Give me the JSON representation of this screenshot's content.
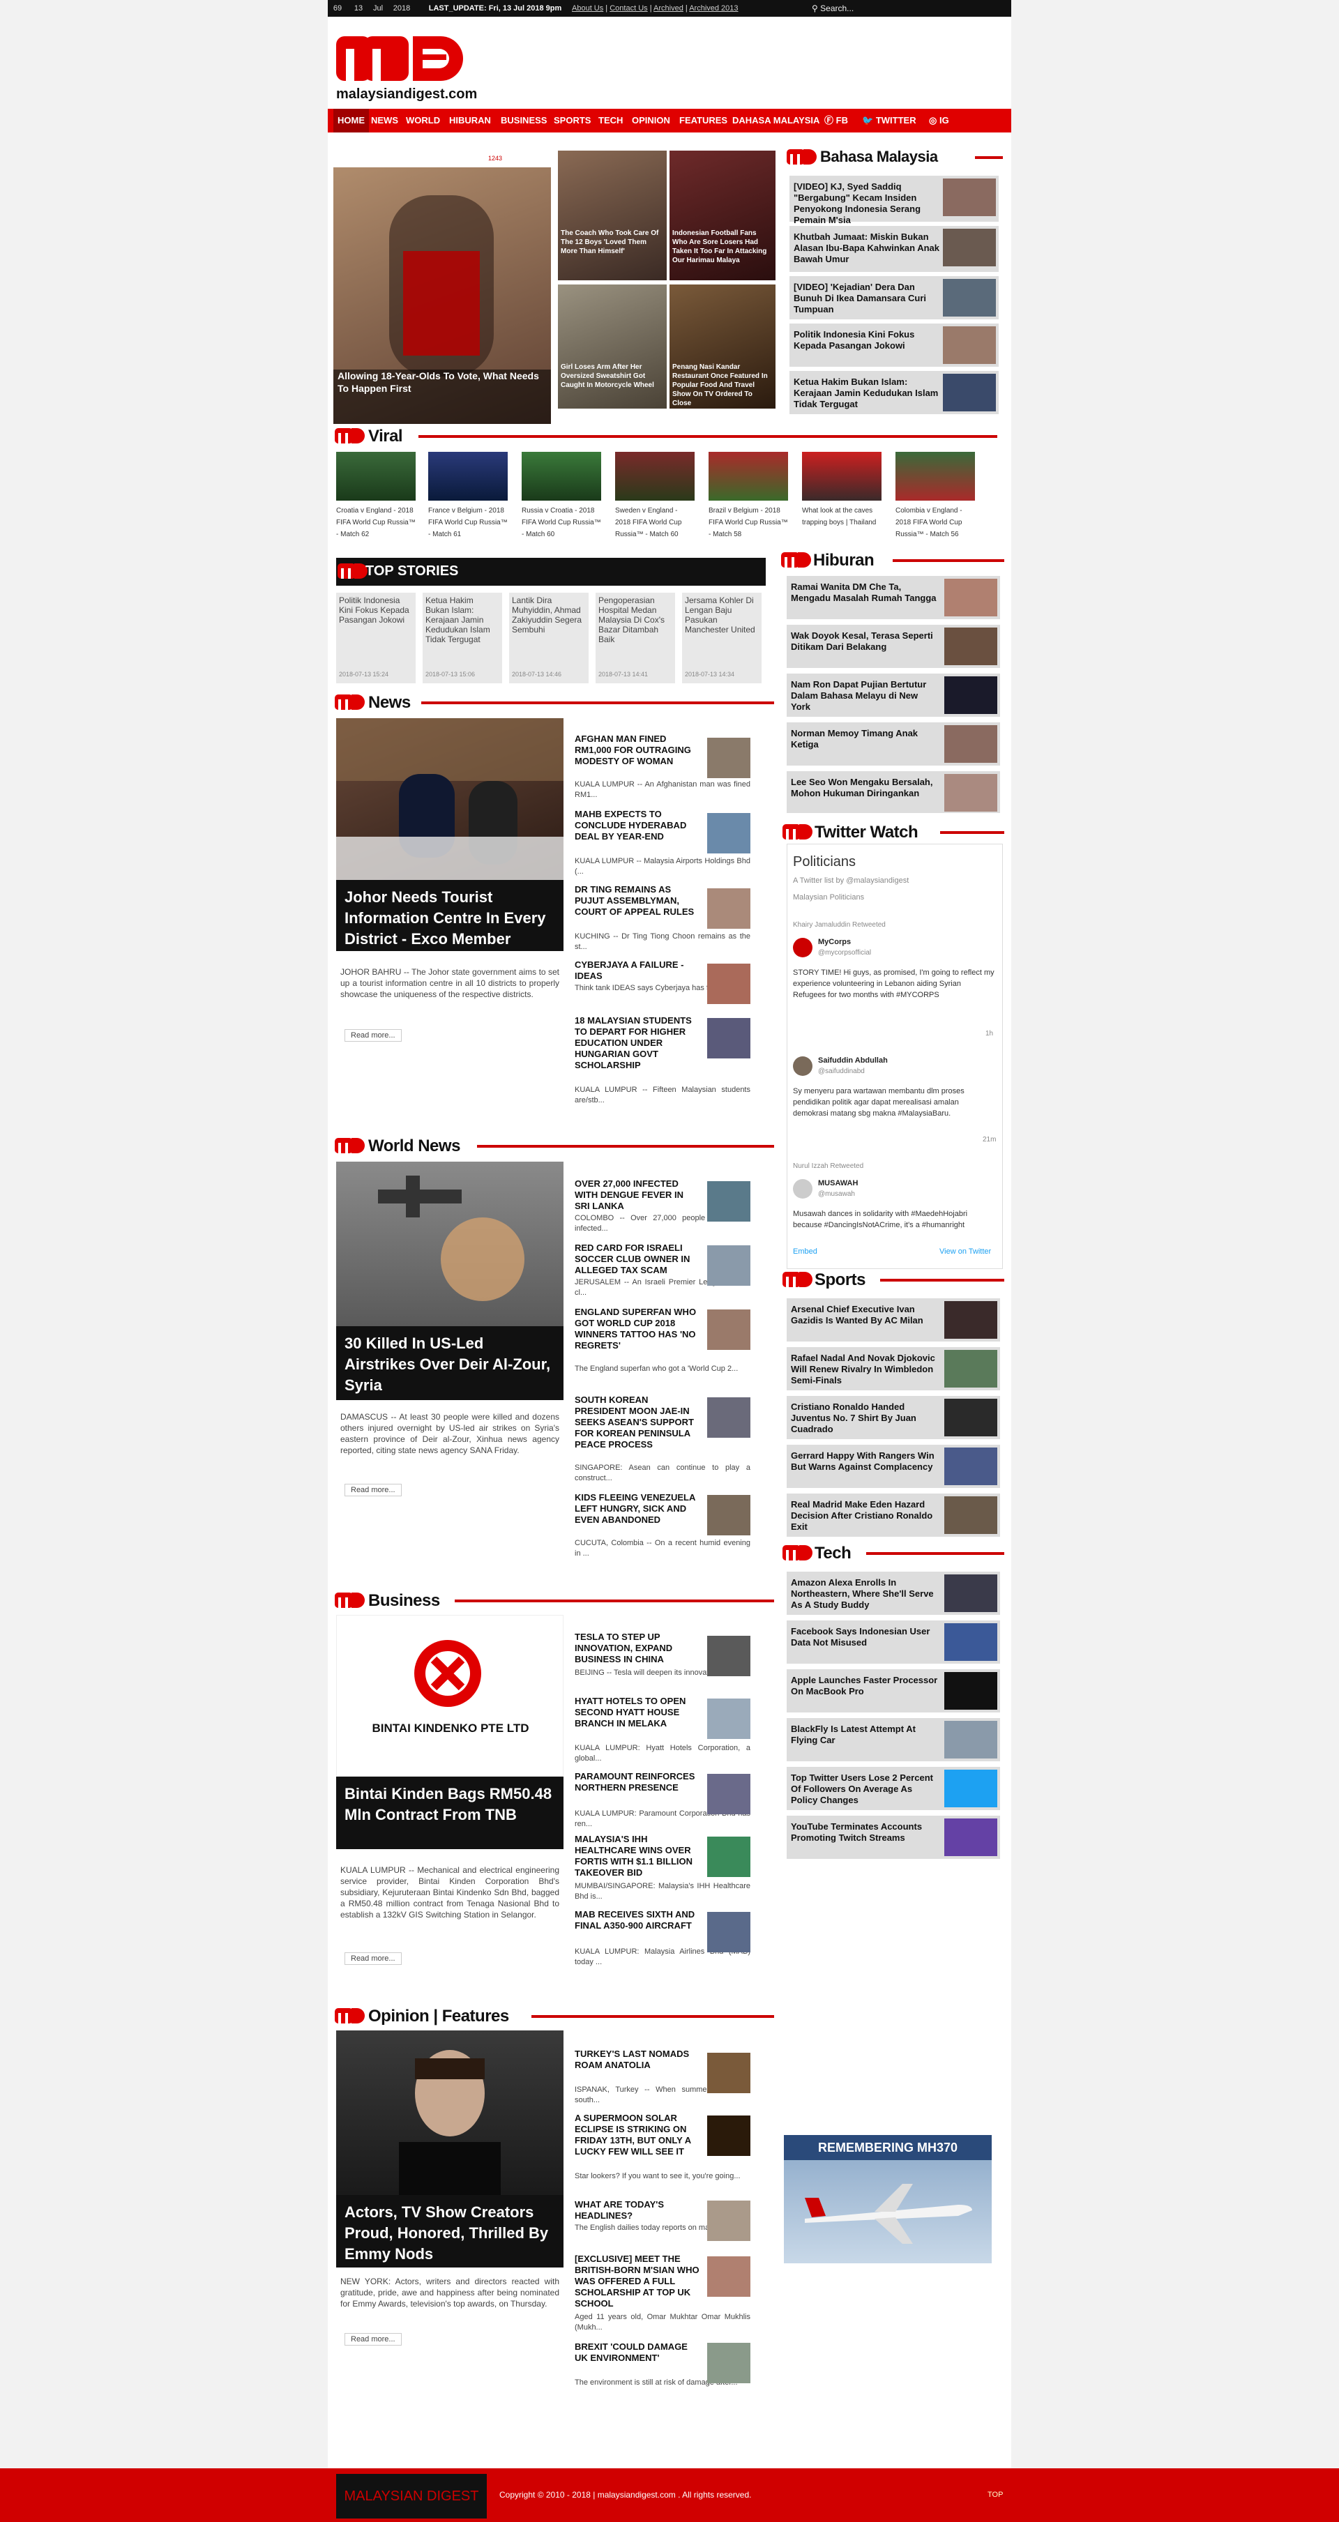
{
  "topbar": {
    "counter": "",
    "b1": "69",
    "b2": "13",
    "b3": "Jul",
    "year": "2018",
    "last_update": "LAST_UPDATE: Fri, 13 Jul 2018 9pm",
    "links": [
      "About Us",
      "Contact Us",
      "Archived",
      "Archived 2013"
    ],
    "search_placeholder": "Search..."
  },
  "logo": {
    "text": "malaysiandigest.com"
  },
  "nav": {
    "items": [
      "HOME",
      "NEWS",
      "WORLD",
      "HIBURAN",
      "BUSINESS",
      "SPORTS",
      "TECH",
      "OPINION",
      "FEATURES",
      "DAHASA MALAYSIA",
      "FB",
      "TWITTER",
      "IG"
    ]
  },
  "hero": {
    "main_title": "Allowing 18-Year-Olds To Vote, What Needs To Happen First",
    "counter": "1243",
    "grid": [
      {
        "title": "The Coach Who Took Care Of The 12 Boys 'Loved Them More Than Himself'"
      },
      {
        "title": "Indonesian Football Fans Who Are Sore Losers Had Taken It Too Far In Attacking Our Harimau Malaya"
      },
      {
        "title": "Girl Loses Arm After Her Oversized Sweatshirt Got Caught In Motorcycle Wheel"
      },
      {
        "title": "Penang Nasi Kandar Restaurant Once Featured In Popular Food And Travel Show On TV Ordered To Close"
      }
    ]
  },
  "bahasa": {
    "heading": "Bahasa Malaysia",
    "items": [
      "[VIDEO] KJ, Syed Saddiq \"Bergabung\" Kecam Insiden Penyokong Indonesia Serang Pemain M'sia",
      "Khutbah Jumaat: Miskin Bukan Alasan Ibu-Bapa Kahwinkan Anak Bawah Umur",
      "[VIDEO] 'Kejadian' Dera Dan Bunuh Di Ikea Damansara Curi Tumpuan",
      "Politik Indonesia Kini Fokus Kepada Pasangan Jokowi",
      "Ketua Hakim Bukan Islam: Kerajaan Jamin Kedudukan Islam Tidak Tergugat"
    ]
  },
  "viral": {
    "heading": "Viral",
    "items": [
      "Croatia v England - 2018 FIFA World Cup Russia™ - Match 62",
      "France v Belgium - 2018 FIFA World Cup Russia™ - Match 61",
      "Russia v Croatia - 2018 FIFA World Cup Russia™ - Match 60",
      "Sweden v England - 2018 FIFA World Cup Russia™ - Match 60",
      "Brazil v Belgium - 2018 FIFA World Cup Russia™ - Match 58",
      "What look at the caves trapping boys | Thailand",
      "Colombia v England - 2018 FIFA World Cup Russia™ - Match 56"
    ]
  },
  "top_stories": {
    "heading": "TOP STORIES",
    "items": [
      {
        "title": "Politik Indonesia Kini Fokus Kepada Pasangan Jokowi",
        "date": "2018-07-13 15:24"
      },
      {
        "title": "Ketua Hakim Bukan Islam: Kerajaan Jamin Kedudukan Islam Tidak Tergugat",
        "date": "2018-07-13 15:06"
      },
      {
        "title": "Lantik Dira Muhyiddin, Ahmad Zakiyuddin Segera Sembuhi",
        "date": "2018-07-13 14:46"
      },
      {
        "title": "Pengoperasian Hospital Medan Malaysia Di Cox's Bazar Ditambah Baik",
        "date": "2018-07-13 14:41"
      },
      {
        "title": "Jersama Kohler Di Lengan Baju Pasukan Manchester United",
        "date": "2018-07-13 14:34"
      }
    ]
  },
  "hiburan": {
    "heading": "Hiburan",
    "items": [
      "Ramai Wanita DM Che Ta, Mengadu Masalah Rumah Tangga",
      "Wak Doyok Kesal, Terasa Seperti Ditikam Dari Belakang",
      "Nam Ron Dapat Pujian Bertutur Dalam Bahasa Melayu di New York",
      "Norman Memoy Timang Anak Ketiga",
      "Lee Seo Won Mengaku Bersalah, Mohon Hukuman Diringankan"
    ]
  },
  "news": {
    "heading": "News",
    "feature_title": "Johor Needs Tourist Information Centre In Every District - Exco Member",
    "feature_excerpt": "JOHOR BAHRU -- The Johor state government aims to set up a tourist information centre in all 10 districts to properly showcase the uniqueness of the respective districts.",
    "read_more": "Read more...",
    "list": [
      {
        "title": "AFGHAN MAN FINED RM1,000 FOR OUTRAGING MODESTY OF WOMAN",
        "ex": "KUALA LUMPUR -- An Afghanistan man was fined RM1..."
      },
      {
        "title": "MAHB EXPECTS TO CONCLUDE HYDERABAD DEAL BY YEAR-END",
        "ex": "KUALA LUMPUR -- Malaysia Airports Holdings Bhd (..."
      },
      {
        "title": "DR TING REMAINS AS PUJUT ASSEMBLYMAN, COURT OF APPEAL RULES",
        "ex": "KUCHING -- Dr Ting Tiong Choon remains as the st..."
      },
      {
        "title": "CYBERJAYA A FAILURE - IDEAS",
        "ex": "Think tank IDEAS says Cyberjaya has failed in it..."
      },
      {
        "title": "18 MALAYSIAN STUDENTS TO DEPART FOR HIGHER EDUCATION UNDER HUNGARIAN GOVT SCHOLARSHIP",
        "ex": "KUALA LUMPUR -- Fifteen Malaysian students are/stb..."
      }
    ]
  },
  "twitter": {
    "heading": "Twitter Watch",
    "title": "Politicians",
    "byline": "A Twitter list by @malaysiandigest",
    "sub": "Malaysian Politicians",
    "tweets": [
      {
        "retweet": "Khairy Jamaluddin Retweeted",
        "name": "MyCorps",
        "handle": "@mycorpsofficial",
        "text": "STORY TIME! Hi guys, as promised, I'm going to reflect my experience volunteering in Lebanon aiding Syrian Refugees for two months with #MYCORPS",
        "meta": "1h"
      },
      {
        "retweet": "",
        "name": "Saifuddin Abdullah",
        "handle": "@saifuddinabd",
        "text": "Sy menyeru para wartawan membantu dlm proses pendidikan politik agar dapat merealisasi amalan demokrasi matang sbg makna #MalaysiaBaru.",
        "meta": "21m"
      },
      {
        "retweet": "Nurul Izzah Retweeted",
        "name": "MUSAWAH",
        "handle": "@musawah",
        "text": "Musawah dances in solidarity with #MaedehHojabri because #DancingIsNotACrime, it's a #humanright",
        "meta": ""
      }
    ],
    "embed": "Embed",
    "view_on": "View on Twitter"
  },
  "world": {
    "heading": "World News",
    "feature_title": "30 Killed In US-Led Airstrikes Over Deir Al-Zour, Syria",
    "feature_excerpt": "DAMASCUS -- At least 30 people were killed and dozens others injured overnight by US-led air strikes on Syria's eastern province of Deir al-Zour, Xinhua news agency reported, citing state news agency SANA Friday.",
    "read_more": "Read more...",
    "list": [
      {
        "title": "OVER 27,000 INFECTED WITH DENGUE FEVER IN SRI LANKA",
        "ex": "COLOMBO -- Over 27,000 people have been infected..."
      },
      {
        "title": "RED CARD FOR ISRAELI SOCCER CLUB OWNER IN ALLEGED TAX SCAM",
        "ex": "JERUSALEM -- An Israeli Premier League soccer cl..."
      },
      {
        "title": "ENGLAND SUPERFAN WHO GOT WORLD CUP 2018 WINNERS TATTOO HAS 'NO REGRETS'",
        "ex": "The England superfan who got a 'World Cup 2..."
      },
      {
        "title": "SOUTH KOREAN PRESIDENT MOON JAE-IN SEEKS ASEAN'S SUPPORT FOR KOREAN PENINSULA PEACE PROCESS",
        "ex": "SINGAPORE: Asean can continue to play a construct..."
      },
      {
        "title": "KIDS FLEEING VENEZUELA LEFT HUNGRY, SICK AND EVEN ABANDONED",
        "ex": "CUCUTA, Colombia -- On a recent humid evening in ..."
      }
    ]
  },
  "sports": {
    "heading": "Sports",
    "items": [
      "Arsenal Chief Executive Ivan Gazidis Is Wanted By AC Milan",
      "Rafael Nadal And Novak Djokovic Will Renew Rivalry In Wimbledon Semi-Finals",
      "Cristiano Ronaldo Handed Juventus No. 7 Shirt By Juan Cuadrado",
      "Gerrard Happy With Rangers Win But Warns Against Complacency",
      "Real Madrid Make Eden Hazard Decision After Cristiano Ronaldo Exit"
    ]
  },
  "tech": {
    "heading": "Tech",
    "items": [
      "Amazon Alexa Enrolls In Northeastern, Where She'll Serve As A Study Buddy",
      "Facebook Says Indonesian User Data Not Misused",
      "Apple Launches Faster Processor On MacBook Pro",
      "BlackFly Is Latest Attempt At Flying Car",
      "Top Twitter Users Lose 2 Percent Of Followers On Average As Policy Changes",
      "YouTube Terminates Accounts Promoting Twitch Streams"
    ]
  },
  "business": {
    "heading": "Business",
    "feature_title": "Bintai Kinden Bags RM50.48 Mln Contract From TNB",
    "feature_logo": "BINTAI KINDENKO PTE LTD",
    "feature_excerpt": "KUALA LUMPUR -- Mechanical and electrical engineering service provider, Bintai Kinden Corporation Bhd's subsidiary, Kejuruteraan Bintai Kindenko Sdn Bhd, bagged a RM50.48 million contract from Tenaga Nasional Bhd to establish a 132kV GIS Switching Station in Selangor.",
    "read_more": "Read more...",
    "list": [
      {
        "title": "TESLA TO STEP UP INNOVATION, EXPAND BUSINESS IN CHINA",
        "ex": "BEIJING -- Tesla will deepen its innovation acti..."
      },
      {
        "title": "HYATT HOTELS TO OPEN SECOND HYATT HOUSE BRANCH IN MELAKA",
        "ex": "KUALA LUMPUR: Hyatt Hotels Corporation, a global..."
      },
      {
        "title": "PARAMOUNT REINFORCES NORTHERN PRESENCE",
        "ex": "KUALA LUMPUR: Paramount Corporation Bhd has ren..."
      },
      {
        "title": "MALAYSIA'S IHH HEALTHCARE WINS OVER FORTIS WITH $1.1 BILLION TAKEOVER BID",
        "ex": "MUMBAI/SINGAPORE: Malaysia's IHH Healthcare Bhd is..."
      },
      {
        "title": "MAB RECEIVES SIXTH AND FINAL A350-900 AIRCRAFT",
        "ex": "KUALA LUMPUR: Malaysia Airlines Bhd (MAB) today ..."
      }
    ]
  },
  "mh370": {
    "text": "REMEMBERING MH370"
  },
  "opinion": {
    "heading": "Opinion | Features",
    "feature_title": "Actors, TV Show Creators Proud, Honored, Thrilled By Emmy Nods",
    "feature_excerpt": "NEW YORK: Actors, writers and directors reacted with gratitude, pride, awe and happiness after being nominated for Emmy Awards, television's top awards, on Thursday.",
    "read_more": "Read more...",
    "list": [
      {
        "title": "TURKEY'S LAST NOMADS ROAM ANATOLIA",
        "ex": "ISPANAK, Turkey -- When summer comes to south..."
      },
      {
        "title": "A SUPERMOON SOLAR ECLIPSE IS STRIKING ON FRIDAY 13TH, BUT ONLY A LUCKY FEW WILL SEE IT",
        "ex": "Star lookers? If you want to see it, you're going..."
      },
      {
        "title": "WHAT ARE TODAY'S HEADLINES?",
        "ex": "The English dailies today reports on major gover..."
      },
      {
        "title": "[EXCLUSIVE] MEET THE BRITISH-BORN M'SIAN WHO WAS OFFERED A FULL SCHOLARSHIP AT TOP UK SCHOOL",
        "ex": "Aged 11 years old, Omar Mukhtar Omar Mukhlis (Mukh..."
      },
      {
        "title": "BREXIT 'COULD DAMAGE UK ENVIRONMENT'",
        "ex": "The environment is still at risk of damage after..."
      }
    ]
  },
  "footer": {
    "brand": "MALAYSIAN DIGEST",
    "copyright": "Copyright © 2010 - 2018 | malaysiandigest.com . All rights reserved.",
    "top": "TOP"
  },
  "colors": {
    "accent": "#e00000",
    "dark": "#111111",
    "sidebar_bg": "#dddddd"
  }
}
